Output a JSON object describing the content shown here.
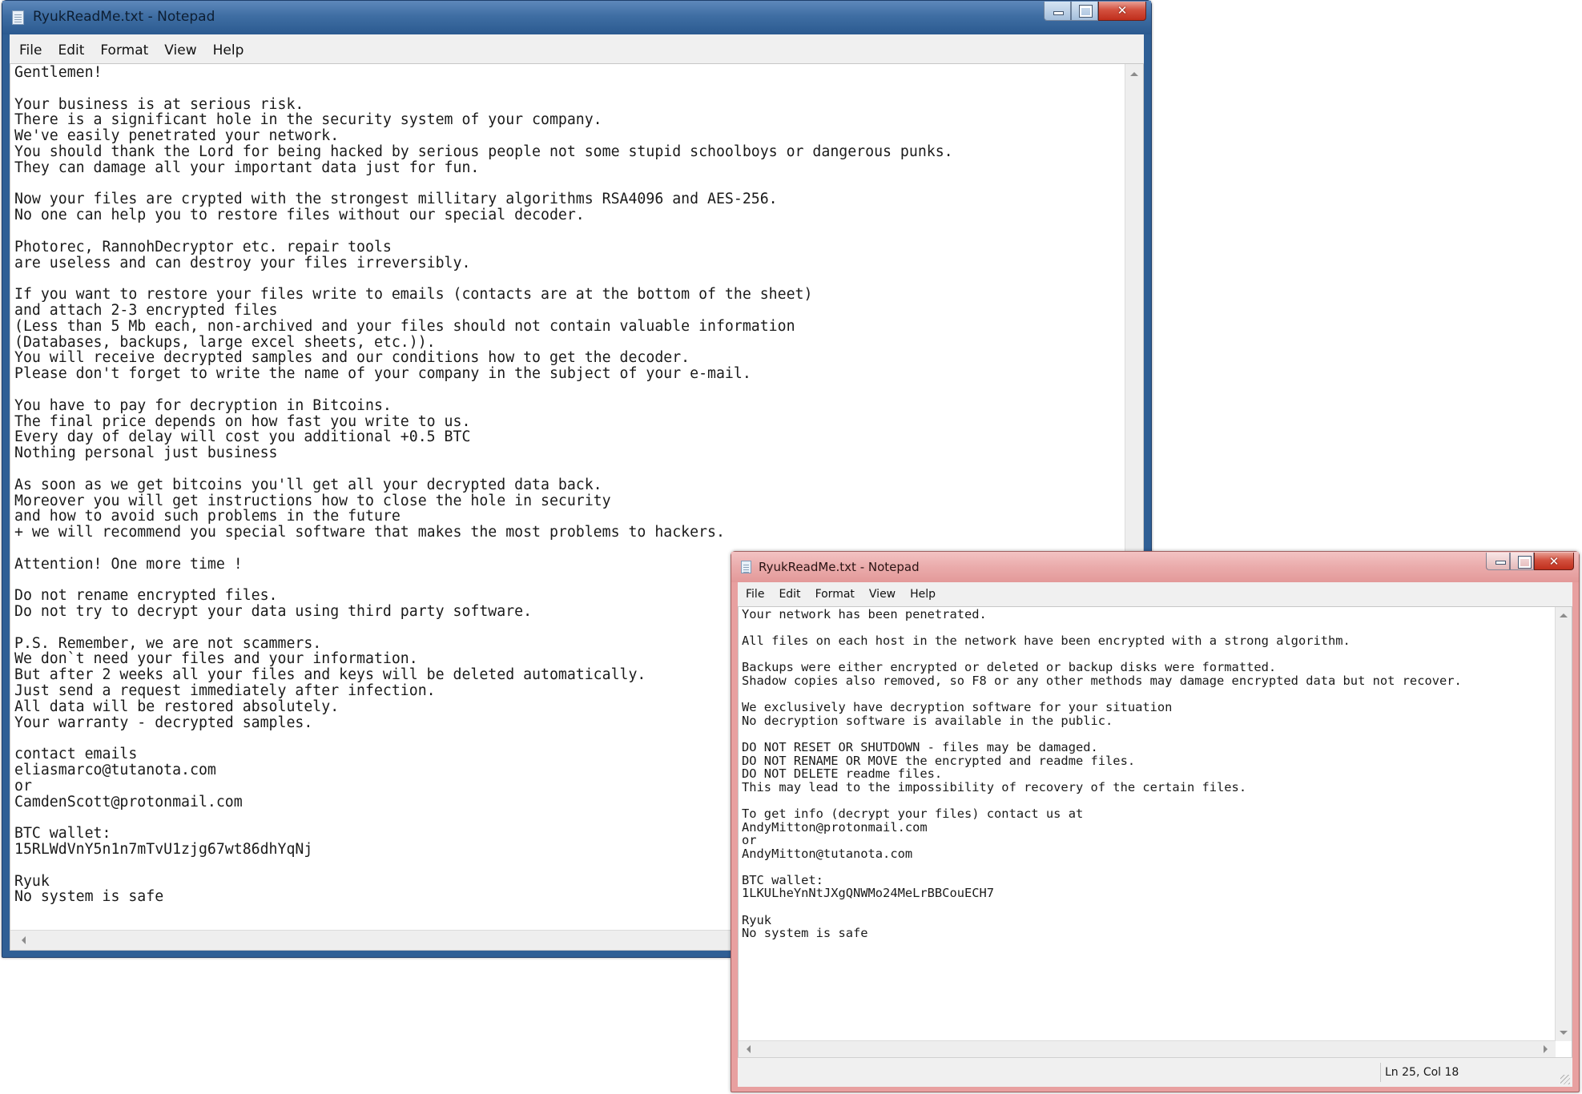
{
  "window1": {
    "title": "RyukReadMe.txt - Notepad",
    "menu": [
      "File",
      "Edit",
      "Format",
      "View",
      "Help"
    ],
    "text": "Gentlemen!\n\nYour business is at serious risk.\nThere is a significant hole in the security system of your company.\nWe've easily penetrated your network.\nYou should thank the Lord for being hacked by serious people not some stupid schoolboys or dangerous punks.\nThey can damage all your important data just for fun.\n\nNow your files are crypted with the strongest millitary algorithms RSA4096 and AES-256.\nNo one can help you to restore files without our special decoder.\n\nPhotorec, RannohDecryptor etc. repair tools\nare useless and can destroy your files irreversibly.\n\nIf you want to restore your files write to emails (contacts are at the bottom of the sheet)\nand attach 2-3 encrypted files\n(Less than 5 Mb each, non-archived and your files should not contain valuable information\n(Databases, backups, large excel sheets, etc.)).\nYou will receive decrypted samples and our conditions how to get the decoder.\nPlease don't forget to write the name of your company in the subject of your e-mail.\n\nYou have to pay for decryption in Bitcoins.\nThe final price depends on how fast you write to us.\nEvery day of delay will cost you additional +0.5 BTC\nNothing personal just business\n\nAs soon as we get bitcoins you'll get all your decrypted data back.\nMoreover you will get instructions how to close the hole in security\nand how to avoid such problems in the future\n+ we will recommend you special software that makes the most problems to hackers.\n\nAttention! One more time !\n\nDo not rename encrypted files.\nDo not try to decrypt your data using third party software.\n\nP.S. Remember, we are not scammers.\nWe don`t need your files and your information.\nBut after 2 weeks all your files and keys will be deleted automatically.\nJust send a request immediately after infection.\nAll data will be restored absolutely.\nYour warranty - decrypted samples.\n\ncontact emails\neliasmarco@tutanota.com\nor\nCamdenScott@protonmail.com\n\nBTC wallet:\n15RLWdVnY5n1n7mTvU1zjg67wt86dhYqNj\n\nRyuk\nNo system is safe"
  },
  "window2": {
    "title": "RyukReadMe.txt - Notepad",
    "menu": [
      "File",
      "Edit",
      "Format",
      "View",
      "Help"
    ],
    "text": "Your network has been penetrated.\n\nAll files on each host in the network have been encrypted with a strong algorithm.\n\nBackups were either encrypted or deleted or backup disks were formatted.\nShadow copies also removed, so F8 or any other methods may damage encrypted data but not recover.\n\nWe exclusively have decryption software for your situation\nNo decryption software is available in the public.\n\nDO NOT RESET OR SHUTDOWN - files may be damaged.\nDO NOT RENAME OR MOVE the encrypted and readme files.\nDO NOT DELETE readme files.\nThis may lead to the impossibility of recovery of the certain files.\n\nTo get info (decrypt your files) contact us at\nAndyMitton@protonmail.com\nor\nAndyMitton@tutanota.com\n\nBTC wallet:\n1LKULheYnNtJXgQNWMo24MeLrBBCouECH7\n\nRyuk\nNo system is safe",
    "status": "Ln 25, Col 18"
  }
}
